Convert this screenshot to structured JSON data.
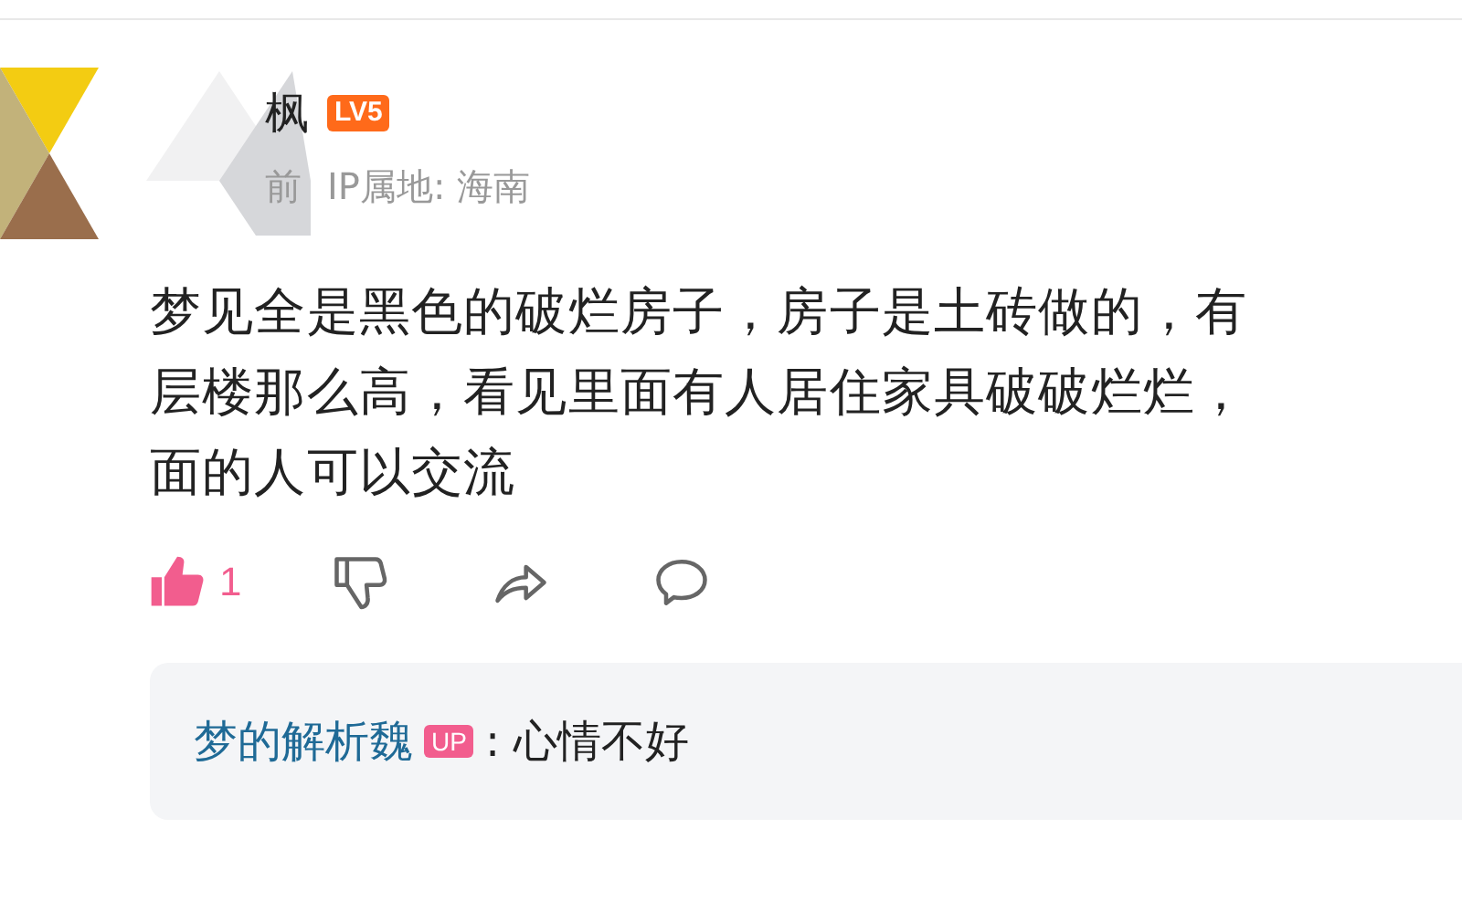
{
  "comment": {
    "user": {
      "name": "枫",
      "level_badge": "LV5"
    },
    "meta": {
      "time": "前",
      "ip_location": "IP属地: 海南"
    },
    "text_lines": [
      "梦见全是黑色的破烂房子，房子是土砖做的，有",
      "层楼那么高，看见里面有人居住家具破破烂烂，",
      "面的人可以交流"
    ],
    "actions": {
      "like_count": "1",
      "liked": true,
      "disliked": false
    },
    "reply": {
      "author": "梦的解析魏",
      "author_badge": "UP",
      "text": ": 心情不好"
    }
  }
}
